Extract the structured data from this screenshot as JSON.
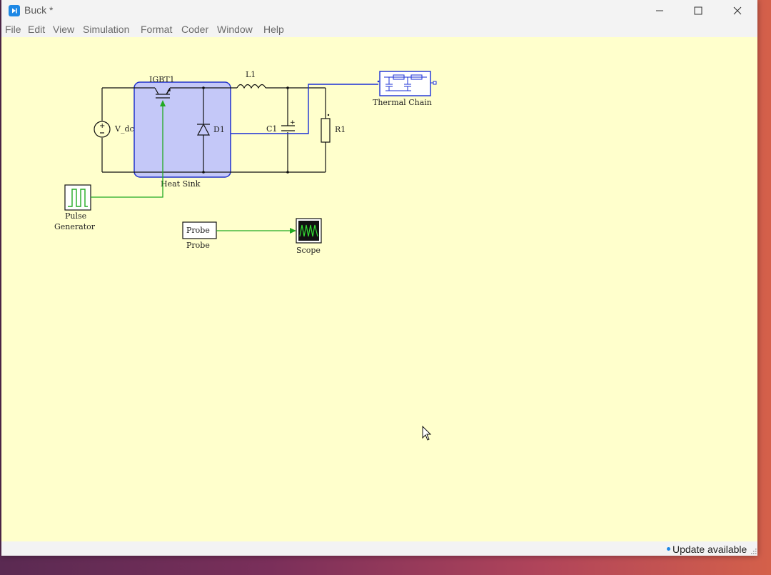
{
  "window": {
    "title": "Buck *",
    "minimize_icon": "minimize-icon",
    "maximize_icon": "maximize-icon",
    "close_icon": "close-icon"
  },
  "menu": [
    "File",
    "Edit",
    "View",
    "Simulation",
    "Format",
    "Coder",
    "Window",
    "Help"
  ],
  "circuit": {
    "vsource_label": "V_dc",
    "igbt_label": "IGBT1",
    "diode_label": "D1",
    "inductor_label": "L1",
    "capacitor_label": "C1",
    "resistor_label": "R1",
    "heatsink_label": "Heat Sink",
    "thermal_chain_label": "Thermal Chain",
    "pulse_label_line1": "Pulse",
    "pulse_label_line2": "Generator",
    "probe_block_text": "Probe",
    "probe_label": "Probe",
    "scope_label": "Scope"
  },
  "colors": {
    "canvas": "#ffffcc",
    "heatsink_fill": "#c4c8f8",
    "heatsink_border": "#2233cc",
    "thermal_wire": "#1a2fd6",
    "signal_wire": "#22aa22",
    "electrical_wire": "#111111"
  },
  "status": {
    "update_text": "Update available"
  }
}
